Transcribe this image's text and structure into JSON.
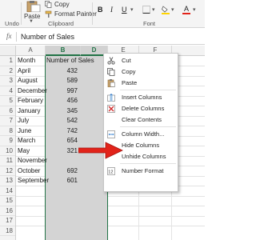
{
  "ribbon": {
    "clipboard": {
      "paste_label": "Paste",
      "copy_label": "Copy",
      "format_painter_label": "Format Painter",
      "group_label": "Clipboard"
    },
    "undo": {
      "group_label": "Undo"
    },
    "font": {
      "group_label": "Font",
      "bold": "B",
      "italic": "I",
      "underline": "U",
      "font_color": "A"
    }
  },
  "formula_bar": {
    "fx": "fx",
    "value": "Number of Sales"
  },
  "grid": {
    "columns": [
      "A",
      "B",
      "C",
      "D",
      "E",
      "F"
    ],
    "rows": [
      "1",
      "2",
      "3",
      "4",
      "5",
      "6",
      "7",
      "8",
      "9",
      "10",
      "11",
      "12",
      "13",
      "14",
      "15",
      "16",
      "17",
      "18"
    ],
    "header_row": {
      "a": "Month",
      "b": "Number of Sales"
    },
    "data": [
      {
        "month": "April",
        "sales": "432"
      },
      {
        "month": "August",
        "sales": "589"
      },
      {
        "month": "December",
        "sales": "997"
      },
      {
        "month": "February",
        "sales": "456"
      },
      {
        "month": "January",
        "sales": "345"
      },
      {
        "month": "July",
        "sales": "542"
      },
      {
        "month": "June",
        "sales": "742"
      },
      {
        "month": "March",
        "sales": "654"
      },
      {
        "month": "May",
        "sales": "321"
      },
      {
        "month": "November",
        "sales": ""
      },
      {
        "month": "October",
        "sales": "692"
      },
      {
        "month": "September",
        "sales": "601"
      }
    ]
  },
  "context_menu": {
    "items": [
      {
        "label": "Cut",
        "icon": "scissors-icon"
      },
      {
        "label": "Copy",
        "icon": "copy-icon"
      },
      {
        "label": "Paste",
        "icon": "paste-icon"
      },
      {
        "label": "Insert Columns",
        "icon": "insert-columns-icon"
      },
      {
        "label": "Delete Columns",
        "icon": "delete-columns-icon"
      },
      {
        "label": "Clear Contents",
        "icon": ""
      },
      {
        "label": "Column Width...",
        "icon": "column-width-icon"
      },
      {
        "label": "Hide Columns",
        "icon": ""
      },
      {
        "label": "Unhide Columns",
        "icon": ""
      },
      {
        "label": "Number Format",
        "icon": "number-format-icon"
      }
    ]
  },
  "colors": {
    "excel_green": "#217346",
    "selection_gray": "#d4d4d4",
    "annotation_red": "#e2231a"
  }
}
